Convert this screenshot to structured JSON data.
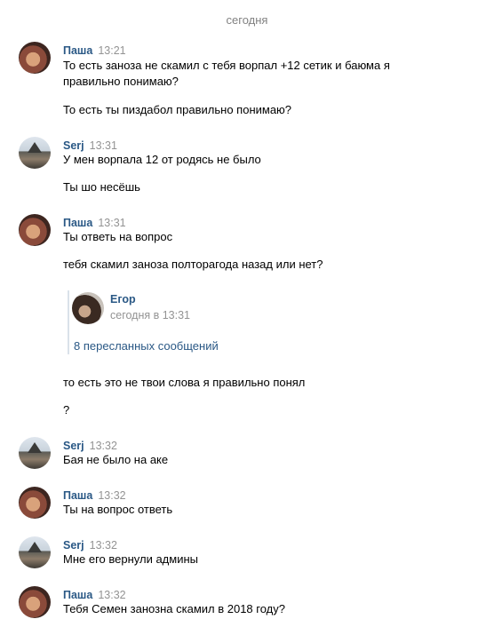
{
  "date_separator": "сегодня",
  "messages": [
    {
      "author": "Паша",
      "time": "13:21",
      "lines": [
        "То есть заноза не скамил с тебя ворпал +12 сетик и баюма я",
        "правильно понимаю?",
        "То есть ты пиздабол правильно понимаю?"
      ]
    },
    {
      "author": "Serj",
      "time": "13:31",
      "lines": [
        "У мен ворпала 12 от родясь не было",
        "Ты шо несёшь"
      ]
    },
    {
      "author": "Паша",
      "time": "13:31",
      "lines": [
        "Ты ответь на вопрос",
        "тебя скамил заноза полторагода назад или нет?",
        "то есть это не твои слова я правильно понял",
        "?"
      ]
    },
    {
      "author": "Serj",
      "time": "13:32",
      "lines": [
        "Бая не было на аке"
      ]
    },
    {
      "author": "Паша",
      "time": "13:32",
      "lines": [
        "Ты на вопрос ответь"
      ]
    },
    {
      "author": "Serj",
      "time": "13:32",
      "lines": [
        "Мне его вернули админы"
      ]
    },
    {
      "author": "Паша",
      "time": "13:32",
      "lines": [
        "Тебя Семен занозна скамил в 2018 году?"
      ]
    }
  ],
  "forwarded": {
    "author": "Егор",
    "time": "сегодня в 13:31",
    "link": "8 пересланных сообщений"
  },
  "colors": {
    "author": "#2a5885",
    "time": "#939393",
    "text": "#000000",
    "fwd_bar": "#dae2ea"
  }
}
